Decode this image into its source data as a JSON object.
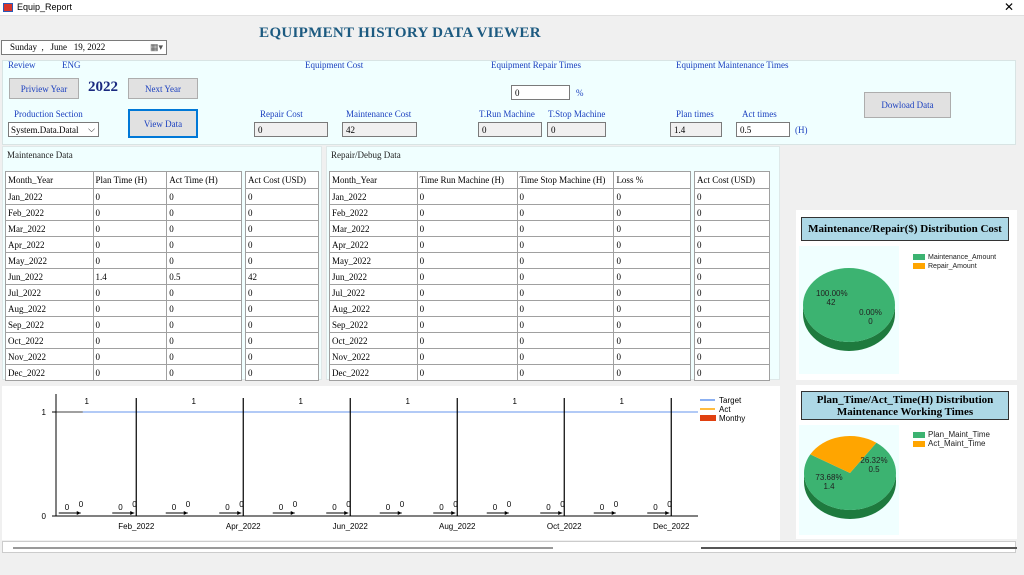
{
  "window": {
    "title": "Equip_Report",
    "close": "✕"
  },
  "main_title": "EQUIPMENT HISTORY DATA VIEWER",
  "date": {
    "weekday": "Sunday",
    "sep": ",",
    "month": "June",
    "day_year": "19, 2022",
    "icon": "calendar-icon"
  },
  "review": {
    "label": "Review",
    "lang": "ENG"
  },
  "headers": {
    "cost": "Equipment  Cost",
    "repair": "Equipment  Repair Times",
    "maint": "Equipment  Maintenance Times"
  },
  "nav": {
    "prev": "Priview Year",
    "year": "2022",
    "next": "Next Year"
  },
  "section": {
    "label": "Production Section",
    "value": "System.Data.Datal",
    "view": "View Data"
  },
  "loss": {
    "value": "0",
    "unit": "%"
  },
  "cost": {
    "repair_label": "Repair Cost",
    "repair_value": "0",
    "maint_label": "Maintenance Cost",
    "maint_value": "42"
  },
  "machine": {
    "run_label": "T.Run Machine",
    "run_value": "0",
    "stop_label": "T.Stop Machine",
    "stop_value": "0"
  },
  "times": {
    "plan_label": "Plan times",
    "plan_value": "1.4",
    "act_label": "Act times",
    "act_value": "0.5",
    "unit": "(H)"
  },
  "download": "Dowload Data",
  "maintenance": {
    "title": "Maintenance Data",
    "headers": [
      "Month_Year",
      "Plan Time (H)",
      "Act Time (H)"
    ],
    "cost_header": "Act Cost (USD)",
    "rows": [
      [
        "Jan_2022",
        "0",
        "0",
        "0"
      ],
      [
        "Feb_2022",
        "0",
        "0",
        "0"
      ],
      [
        "Mar_2022",
        "0",
        "0",
        "0"
      ],
      [
        "Apr_2022",
        "0",
        "0",
        "0"
      ],
      [
        "May_2022",
        "0",
        "0",
        "0"
      ],
      [
        "Jun_2022",
        "1.4",
        "0.5",
        "42"
      ],
      [
        "Jul_2022",
        "0",
        "0",
        "0"
      ],
      [
        "Aug_2022",
        "0",
        "0",
        "0"
      ],
      [
        "Sep_2022",
        "0",
        "0",
        "0"
      ],
      [
        "Oct_2022",
        "0",
        "0",
        "0"
      ],
      [
        "Nov_2022",
        "0",
        "0",
        "0"
      ],
      [
        "Dec_2022",
        "0",
        "0",
        "0"
      ]
    ]
  },
  "repair": {
    "title": "Repair/Debug Data",
    "headers": [
      "Month_Year",
      "Time Run Machine (H)",
      "Time Stop Machine (H)",
      "Loss %"
    ],
    "cost_header": "Act Cost (USD)",
    "rows": [
      [
        "Jan_2022",
        "0",
        "0",
        "0",
        "0"
      ],
      [
        "Feb_2022",
        "0",
        "0",
        "0",
        "0"
      ],
      [
        "Mar_2022",
        "0",
        "0",
        "0",
        "0"
      ],
      [
        "Apr_2022",
        "0",
        "0",
        "0",
        "0"
      ],
      [
        "May_2022",
        "0",
        "0",
        "0",
        "0"
      ],
      [
        "Jun_2022",
        "0",
        "0",
        "0",
        "0"
      ],
      [
        "Jul_2022",
        "0",
        "0",
        "0",
        "0"
      ],
      [
        "Aug_2022",
        "0",
        "0",
        "0",
        "0"
      ],
      [
        "Sep_2022",
        "0",
        "0",
        "0",
        "0"
      ],
      [
        "Oct_2022",
        "0",
        "0",
        "0",
        "0"
      ],
      [
        "Nov_2022",
        "0",
        "0",
        "0",
        "0"
      ],
      [
        "Dec_2022",
        "0",
        "0",
        "0",
        "0"
      ]
    ]
  },
  "pie_cost": {
    "title": "Maintenance/Repair($) Distribution Cost",
    "legend": [
      "Maintenance_Amount",
      "Repair_Amount"
    ],
    "colors": [
      "#3cb371",
      "#ffa500"
    ],
    "values": [
      42,
      0
    ],
    "labels": [
      {
        "pct": "100.00%",
        "val": "42"
      },
      {
        "pct": "0.00%",
        "val": "0"
      }
    ]
  },
  "pie_time": {
    "title_line1": "Plan_Time/Act_Time(H) Distribution",
    "title_line2": "Maintenance Working Times",
    "legend": [
      "Plan_Maint_Time",
      "Act_Maint_Time"
    ],
    "colors": [
      "#3cb371",
      "#ffa500"
    ],
    "values": [
      1.4,
      0.5
    ],
    "labels": [
      {
        "pct": "73.68%",
        "val": "1.4"
      },
      {
        "pct": "26.32%",
        "val": "0.5"
      }
    ]
  },
  "chart_data": {
    "type": "line",
    "x": [
      "Jan_2022",
      "Feb_2022",
      "Mar_2022",
      "Apr_2022",
      "May_2022",
      "Jun_2022",
      "Jul_2022",
      "Aug_2022",
      "Sep_2022",
      "Oct_2022",
      "Nov_2022",
      "Dec_2022"
    ],
    "x_tick_labels": [
      "Feb_2022",
      "Apr_2022",
      "Jun_2022",
      "Aug_2022",
      "Oct_2022",
      "Dec_2022"
    ],
    "y_ticks": [
      "0",
      "1"
    ],
    "ylim": [
      0,
      1
    ],
    "series": [
      {
        "name": "Target",
        "color": "#6495ed",
        "values": [
          1,
          1,
          1,
          1,
          1,
          1,
          1,
          1,
          1,
          1,
          1,
          1
        ]
      },
      {
        "name": "Act",
        "color": "#ffa500",
        "values": [
          0,
          0,
          0,
          0,
          0,
          0,
          0,
          0,
          0,
          0,
          0,
          0
        ]
      },
      {
        "name": "Monthy",
        "color": "#e04010",
        "values": [
          0,
          0,
          0,
          0,
          0,
          0,
          0,
          0,
          0,
          0,
          0,
          0
        ]
      }
    ],
    "target_labels": [
      "1",
      "1",
      "1",
      "1",
      "1",
      "1"
    ],
    "zero_labels": [
      "0",
      "0",
      "0",
      "0",
      "0",
      "0",
      "0",
      "0",
      "0",
      "0",
      "0",
      "0",
      "0",
      "0",
      "0",
      "0",
      "0",
      "0",
      "0",
      "0",
      "0",
      "0",
      "0",
      "0"
    ]
  }
}
